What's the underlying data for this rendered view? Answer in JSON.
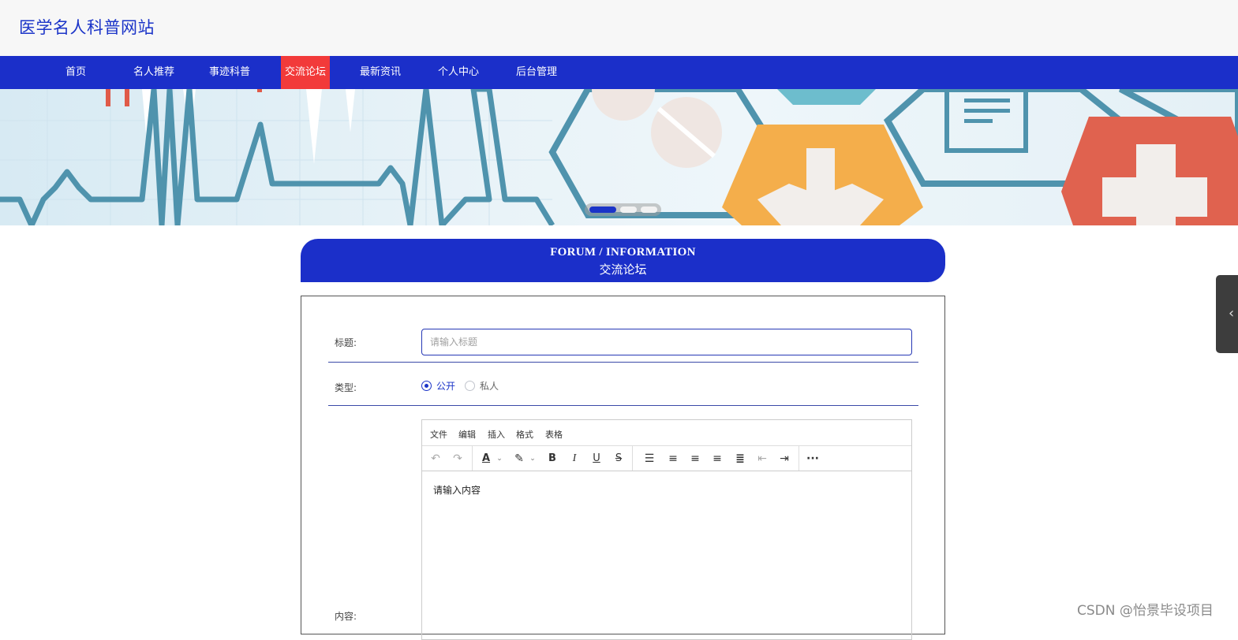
{
  "header": {
    "site_title": "医学名人科普网站"
  },
  "nav": {
    "items": [
      {
        "label": "首页"
      },
      {
        "label": "名人推荐"
      },
      {
        "label": "事迹科普"
      },
      {
        "label": "交流论坛",
        "active": true
      },
      {
        "label": "最新资讯"
      },
      {
        "label": "个人中心"
      },
      {
        "label": "后台管理"
      }
    ]
  },
  "banner": {
    "active_slide": 1,
    "slide_count": 3
  },
  "section": {
    "title_en": "FORUM / INFORMATION",
    "title_cn": "交流论坛"
  },
  "form": {
    "title_label": "标题:",
    "title_placeholder": "请输入标题",
    "type_label": "类型:",
    "type_options": [
      {
        "label": "公开",
        "checked": true
      },
      {
        "label": "私人",
        "checked": false
      }
    ],
    "content_label": "内容:",
    "editor": {
      "menus": [
        "文件",
        "编辑",
        "插入",
        "格式",
        "表格"
      ],
      "placeholder": "请输入内容",
      "toolbar_icons": [
        "undo-icon",
        "redo-icon",
        "font-color-icon",
        "highlight-icon",
        "bold-icon",
        "italic-icon",
        "underline-icon",
        "strikethrough-icon",
        "line-height-icon",
        "align-left-icon",
        "align-center-icon",
        "align-right-icon",
        "justify-icon",
        "outdent-icon",
        "indent-icon",
        "more-icon"
      ]
    }
  },
  "watermark": "CSDN @怡景毕设项目",
  "colors": {
    "primary": "#1b2fc9",
    "active_nav": "#f23a3a",
    "header_bg": "#f7f7f7"
  }
}
